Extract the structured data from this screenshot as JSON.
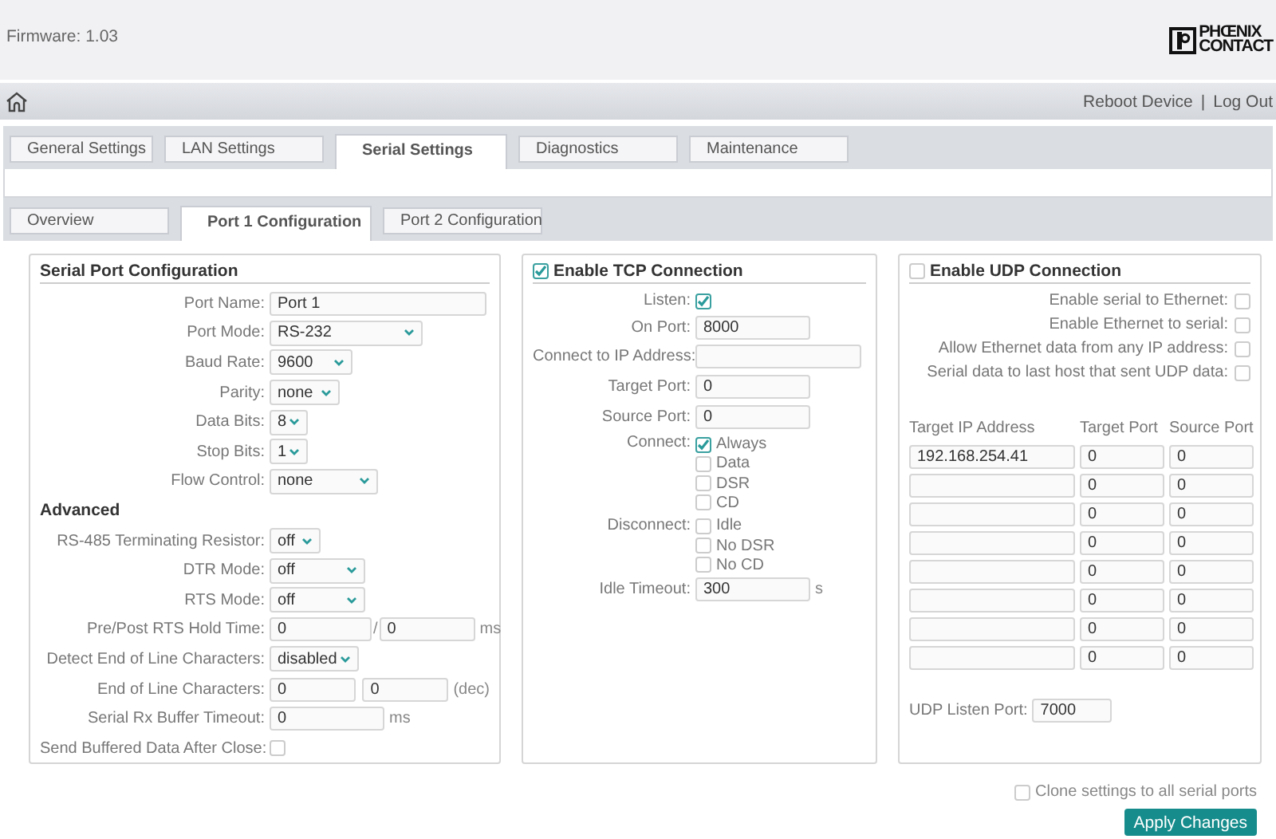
{
  "header": {
    "firmware": "Firmware: 1.03",
    "logo": [
      "PHŒNIX",
      "CONTACT"
    ]
  },
  "nav": {
    "links": [
      "Reboot Device",
      "Log Out"
    ],
    "separator": "|"
  },
  "tabs": [
    {
      "label": "General Settings",
      "selected": false
    },
    {
      "label": "LAN Settings",
      "selected": false
    },
    {
      "label": "Serial Settings",
      "selected": true
    },
    {
      "label": "Diagnostics",
      "selected": false
    },
    {
      "label": "Maintenance",
      "selected": false
    }
  ],
  "subtabs": [
    {
      "label": "Overview",
      "selected": false
    },
    {
      "label": "Port 1 Configuration",
      "selected": true
    },
    {
      "label": "Port 2 Configuration",
      "selected": false
    }
  ],
  "serial_port": {
    "title": "Serial Port Configuration",
    "fields": [
      {
        "kind": "text",
        "label": "Port Name:",
        "value": "Port 1"
      },
      {
        "kind": "select",
        "label": "Port Mode:",
        "value": "RS-232"
      },
      {
        "kind": "select",
        "label": "Baud Rate:",
        "value": "9600"
      },
      {
        "kind": "select",
        "label": "Parity:",
        "value": "none"
      },
      {
        "kind": "select",
        "label": "Data Bits:",
        "value": "8"
      },
      {
        "kind": "select",
        "label": "Stop Bits:",
        "value": "1"
      },
      {
        "kind": "select",
        "label": "Flow Control:",
        "value": "none"
      },
      {
        "kind": "heading",
        "label": "Advanced"
      },
      {
        "kind": "select",
        "label": "RS-485 Terminating Resistor:",
        "value": "off"
      },
      {
        "kind": "select",
        "label": "DTR Mode:",
        "value": "off"
      },
      {
        "kind": "select",
        "label": "RTS Mode:",
        "value": "off"
      },
      {
        "kind": "pair",
        "label": "Pre/Post RTS Hold Time:",
        "values": [
          "0",
          "0"
        ],
        "separator": "/",
        "unit": "ms"
      },
      {
        "kind": "select",
        "label": "Detect End of Line Characters:",
        "value": "disabled"
      },
      {
        "kind": "pair",
        "label": "End of Line Characters:",
        "values": [
          "0",
          "0"
        ],
        "unit": "(dec)"
      },
      {
        "kind": "text",
        "label": "Serial Rx Buffer Timeout:",
        "value": "0",
        "unit": "ms"
      },
      {
        "kind": "checkbox",
        "label": "Send Buffered Data After Close:",
        "checked": false
      }
    ]
  },
  "tcp": {
    "title": "Enable TCP Connection",
    "enabled": true,
    "fields": [
      {
        "kind": "checkbox",
        "label": "Listen:",
        "checked": true
      },
      {
        "kind": "text",
        "label": "On Port:",
        "value": "8000"
      },
      {
        "kind": "text",
        "label": "Connect to IP Address:"
      },
      {
        "kind": "text",
        "label": "Target Port:",
        "value": "0"
      },
      {
        "kind": "text",
        "label": "Source Port:",
        "value": "0"
      },
      {
        "kind": "options",
        "label": "Connect:",
        "options": [
          {
            "label": "Always",
            "checked": true
          },
          {
            "label": "Data",
            "checked": false
          },
          {
            "label": "DSR",
            "checked": false
          },
          {
            "label": "CD",
            "checked": false
          }
        ]
      },
      {
        "kind": "options",
        "label": "Disconnect:",
        "options": [
          {
            "label": "Idle",
            "checked": false
          },
          {
            "label": "No DSR",
            "checked": false
          },
          {
            "label": "No CD",
            "checked": false
          }
        ]
      },
      {
        "kind": "text",
        "label": "Idle Timeout:",
        "value": "300",
        "unit": "s"
      }
    ]
  },
  "udp": {
    "title": "Enable UDP Connection",
    "enabled": false,
    "options": [
      {
        "label": "Enable serial to Ethernet:",
        "checked": false
      },
      {
        "label": "Enable Ethernet to serial:",
        "checked": false
      },
      {
        "label": "Allow Ethernet data from any IP address:",
        "checked": false
      },
      {
        "label": "Serial data to last host that sent UDP data:",
        "checked": false
      }
    ],
    "table": {
      "columns": [
        "Target IP Address",
        "Target Port",
        "Source Port"
      ],
      "rows": [
        {
          "ip": "192.168.254.41",
          "target_port": "0",
          "source_port": "0"
        },
        {
          "target_port": "0",
          "source_port": "0"
        },
        {
          "target_port": "0",
          "source_port": "0"
        },
        {
          "target_port": "0",
          "source_port": "0"
        },
        {
          "target_port": "0",
          "source_port": "0"
        },
        {
          "target_port": "0",
          "source_port": "0"
        },
        {
          "target_port": "0",
          "source_port": "0"
        },
        {
          "target_port": "0",
          "source_port": "0"
        }
      ]
    },
    "listen_port": {
      "label": "UDP Listen Port:",
      "value": "7000"
    }
  },
  "footer": {
    "clone": {
      "label": "Clone settings to all serial ports",
      "checked": false
    },
    "apply": "Apply Changes"
  }
}
